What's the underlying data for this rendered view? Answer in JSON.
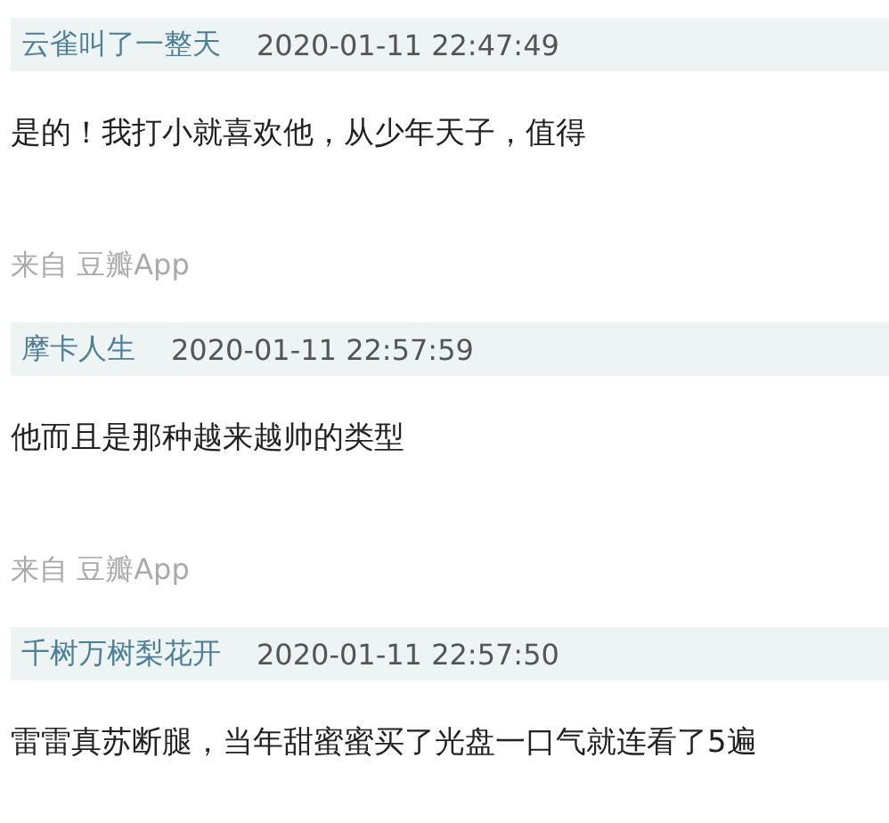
{
  "comments": [
    {
      "author": "云雀叫了一整天",
      "time": "2020-01-11 22:47:49",
      "text": "是的！我打小就喜欢他，从少年天子，值得",
      "source": "来自 豆瓣App"
    },
    {
      "author": "摩卡人生",
      "time": "2020-01-11 22:57:59",
      "text": "他而且是那种越来越帅的类型",
      "source": "来自 豆瓣App"
    },
    {
      "author": "千树万树梨花开",
      "time": "2020-01-11 22:57:50",
      "text": "雷雷真苏断腿，当年甜蜜蜜买了光盘一口气就连看了5遍"
    }
  ]
}
